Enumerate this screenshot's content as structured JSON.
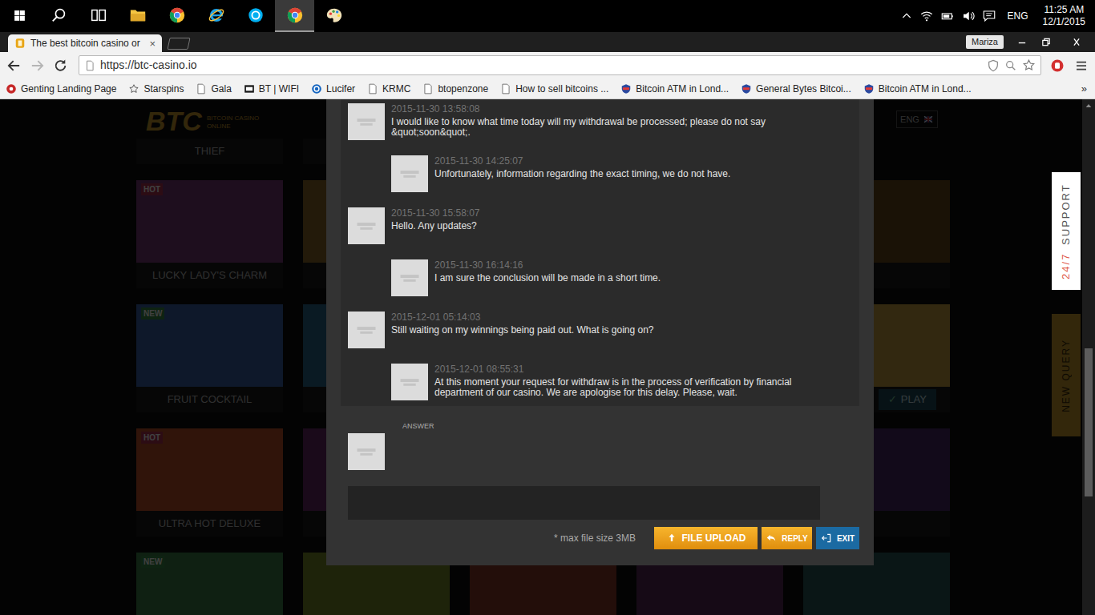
{
  "taskbar": {
    "apps": [
      {
        "kind": "start",
        "selected": false
      },
      {
        "kind": "search",
        "selected": false
      },
      {
        "kind": "taskview",
        "selected": false
      },
      {
        "kind": "explorer",
        "selected": false
      },
      {
        "kind": "chrome",
        "selected": false
      },
      {
        "kind": "ie",
        "selected": false
      },
      {
        "kind": "skype",
        "selected": false
      },
      {
        "kind": "chrome",
        "selected": true
      },
      {
        "kind": "paint",
        "selected": false
      }
    ],
    "tray": {
      "language": "ENG",
      "time": "11:25 AM",
      "date": "12/1/2015"
    }
  },
  "browser": {
    "tab": {
      "title": "The best bitcoin casino or",
      "close": "×",
      "selected": true
    },
    "profile": "Mariza",
    "forward_enabled": false,
    "url": "https://btc-casino.io",
    "bookmarks": [
      {
        "label": "Genting Landing Page",
        "kind": "genting"
      },
      {
        "label": "Starspins",
        "kind": "star"
      },
      {
        "label": "Gala",
        "kind": "page"
      },
      {
        "label": "BT | WIFI",
        "kind": "bt"
      },
      {
        "label": "Lucifer",
        "kind": "ring"
      },
      {
        "label": "KRMC",
        "kind": "page"
      },
      {
        "label": "btopenzone",
        "kind": "page"
      },
      {
        "label": "How to sell bitcoins ...",
        "kind": "page"
      },
      {
        "label": "Bitcoin ATM in Lond...",
        "kind": "btc"
      },
      {
        "label": "General Bytes Bitcoi...",
        "kind": "btc"
      },
      {
        "label": "Bitcoin ATM in Lond...",
        "kind": "btc"
      }
    ],
    "bookmarks_more": "»"
  },
  "page": {
    "logo": {
      "title": "BTC",
      "subtitle": "BITCOIN CASINO ONLINE"
    },
    "language": "ENG",
    "first_label": "THIEF",
    "tiles": [
      {
        "label": "LUCKY LADY'S CHARM",
        "badge": "HOT",
        "color": "#b03050"
      },
      {
        "label": "FRUIT COCKTAIL",
        "badge": "NEW",
        "color": "#3a8a4a"
      },
      {
        "label": "ULTRA HOT DELUXE",
        "badge": "HOT",
        "color": "#b03050"
      },
      {
        "label": "",
        "badge": "NEW",
        "color": "#3a8a4a"
      }
    ],
    "play": {
      "icon": "✓",
      "label": "PLAY"
    }
  },
  "support_tab": {
    "hours": "24/7",
    "label": "SUPPORT"
  },
  "new_query_tab": {
    "label": "NEW QUERY"
  },
  "chat": {
    "messages": [
      {
        "kind": "user",
        "time": "2015-11-30 13:58:08",
        "text": "I would like to know what time today will my withdrawal be processed; please do not say &quot;soon&quot;."
      },
      {
        "kind": "support",
        "time": "2015-11-30 14:25:07",
        "text": "Unfortunately, information regarding the exact timing, we do not have."
      },
      {
        "kind": "user",
        "time": "2015-11-30 15:58:07",
        "text": "Hello. Any updates?"
      },
      {
        "kind": "support",
        "time": "2015-11-30 16:14:16",
        "text": "I am sure the conclusion will be made in a short time."
      },
      {
        "kind": "user",
        "time": "2015-12-01 05:14:03",
        "text": "Still waiting on my winnings being paid out. What is going on?"
      },
      {
        "kind": "support",
        "time": "2015-12-01 08:55:31",
        "text": "At this moment your request for withdraw is in the process of verification by financial department of our casino. We are apologise for this delay. Please, wait."
      }
    ],
    "answer_label": "ANSWER",
    "reply_text": "",
    "file_note": "* max file size 3MB",
    "buttons": [
      {
        "label": "FILE UPLOAD",
        "kind": "upload"
      },
      {
        "label": "REPLY",
        "kind": "reply"
      },
      {
        "label": "EXIT",
        "kind": "exit"
      }
    ]
  }
}
